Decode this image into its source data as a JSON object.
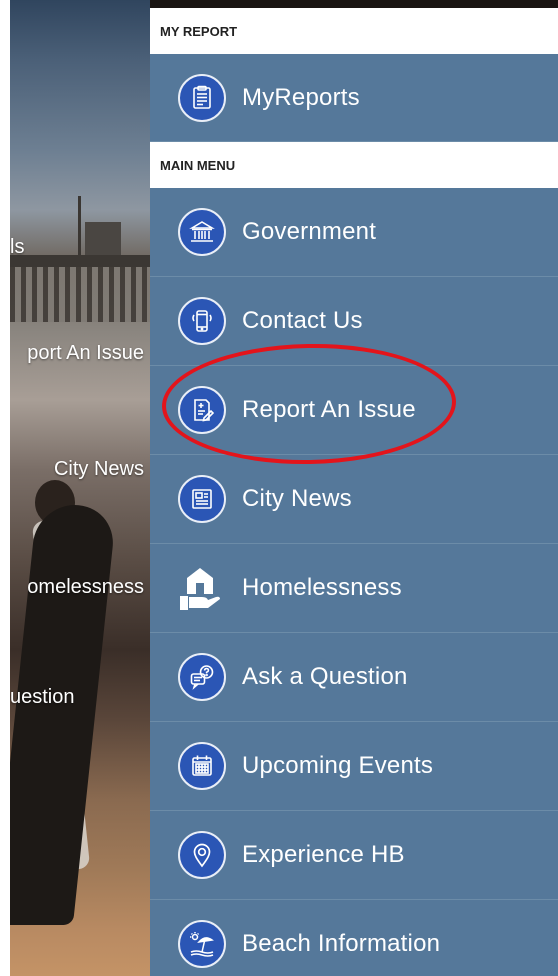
{
  "background_labels": [
    {
      "text": "ls"
    },
    {
      "text": "port An Issue"
    },
    {
      "text": "City News"
    },
    {
      "text": "omelessness"
    },
    {
      "text": "uestion"
    }
  ],
  "drawer": {
    "sections": [
      {
        "header": "MY REPORT",
        "items": [
          {
            "label": "MyReports",
            "icon": "clipboard-report-icon"
          }
        ]
      },
      {
        "header": "MAIN MENU",
        "items": [
          {
            "label": "Government",
            "icon": "government-building-icon"
          },
          {
            "label": "Contact Us",
            "icon": "mobile-phone-icon"
          },
          {
            "label": "Report An Issue",
            "icon": "report-form-icon"
          },
          {
            "label": "City News",
            "icon": "newspaper-icon"
          },
          {
            "label": "Homelessness",
            "icon": "home-hand-icon"
          },
          {
            "label": "Ask a Question",
            "icon": "question-bubble-icon"
          },
          {
            "label": "Upcoming Events",
            "icon": "calendar-icon"
          },
          {
            "label": "Experience HB",
            "icon": "location-pin-icon"
          },
          {
            "label": "Beach Information",
            "icon": "beach-umbrella-icon"
          }
        ]
      }
    ]
  },
  "colors": {
    "drawer_bg": "#55789a",
    "icon_circle": "#2b56b5",
    "highlight": "#e3141b"
  }
}
